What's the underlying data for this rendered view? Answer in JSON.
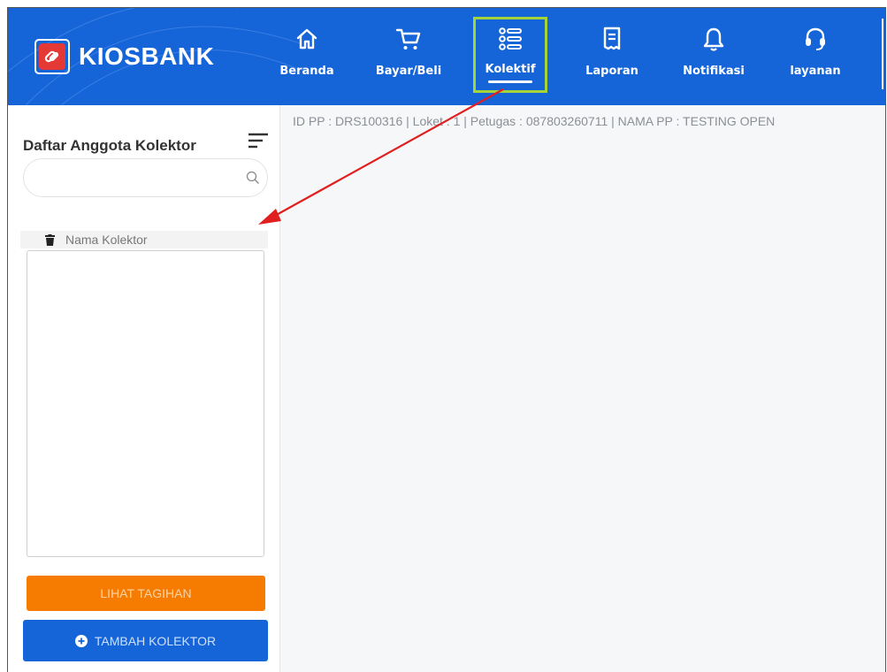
{
  "app": {
    "brand": "KIOSBANK"
  },
  "nav": {
    "items": [
      {
        "label": "Beranda",
        "icon": "home-icon"
      },
      {
        "label": "Bayar/Beli",
        "icon": "cart-icon"
      },
      {
        "label": "Kolektif",
        "icon": "list-icon",
        "active": true
      },
      {
        "label": "Laporan",
        "icon": "receipt-icon"
      },
      {
        "label": "Notifikasi",
        "icon": "bell-icon"
      },
      {
        "label": "layanan",
        "icon": "headset-icon"
      }
    ]
  },
  "sidebar": {
    "title": "Daftar Anggota Kolektor",
    "search": {
      "value": "",
      "placeholder": ""
    },
    "list_header": "Nama Kolektor",
    "collectors": [],
    "lihat_tagihan_label": "LIHAT TAGIHAN",
    "tambah_kolektor_label": "TAMBAH KOLEKTOR"
  },
  "main": {
    "info_bar": "ID PP : DRS100316 | Loket : 1 | Petugas : 087803260711 | NAMA PP : TESTING OPEN"
  },
  "colors": {
    "header_bg": "#1565d8",
    "active_outline": "#a4d33a",
    "orange_button": "#f57c00",
    "blue_button": "#1565d8",
    "annotation_arrow": "#e02020"
  }
}
